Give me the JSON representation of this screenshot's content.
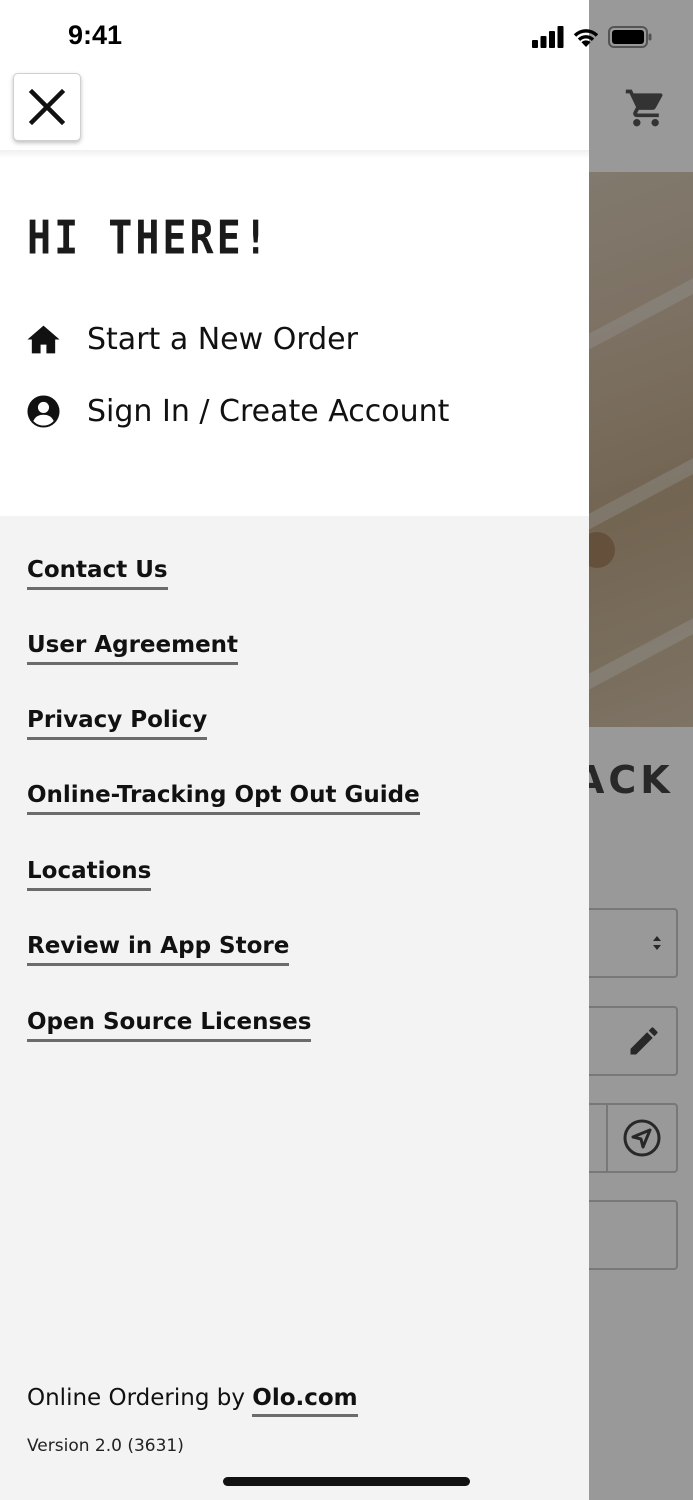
{
  "status_bar": {
    "time": "9:41"
  },
  "background": {
    "heading_fragment": "ACK"
  },
  "drawer": {
    "close_label": "Close menu",
    "greeting": "HI THERE!",
    "nav": [
      {
        "label": "Start a New Order",
        "icon": "home-icon"
      },
      {
        "label": "Sign In / Create Account",
        "icon": "account-circle-icon"
      }
    ],
    "links": [
      "Contact Us",
      "User Agreement",
      "Privacy Policy",
      "Online-Tracking Opt Out Guide",
      "Locations",
      "Review in App Store",
      "Open Source Licenses"
    ],
    "footer": {
      "prefix": "Online Ordering by ",
      "olo_link": "Olo.com",
      "version": "Version 2.0 (3631)"
    }
  }
}
